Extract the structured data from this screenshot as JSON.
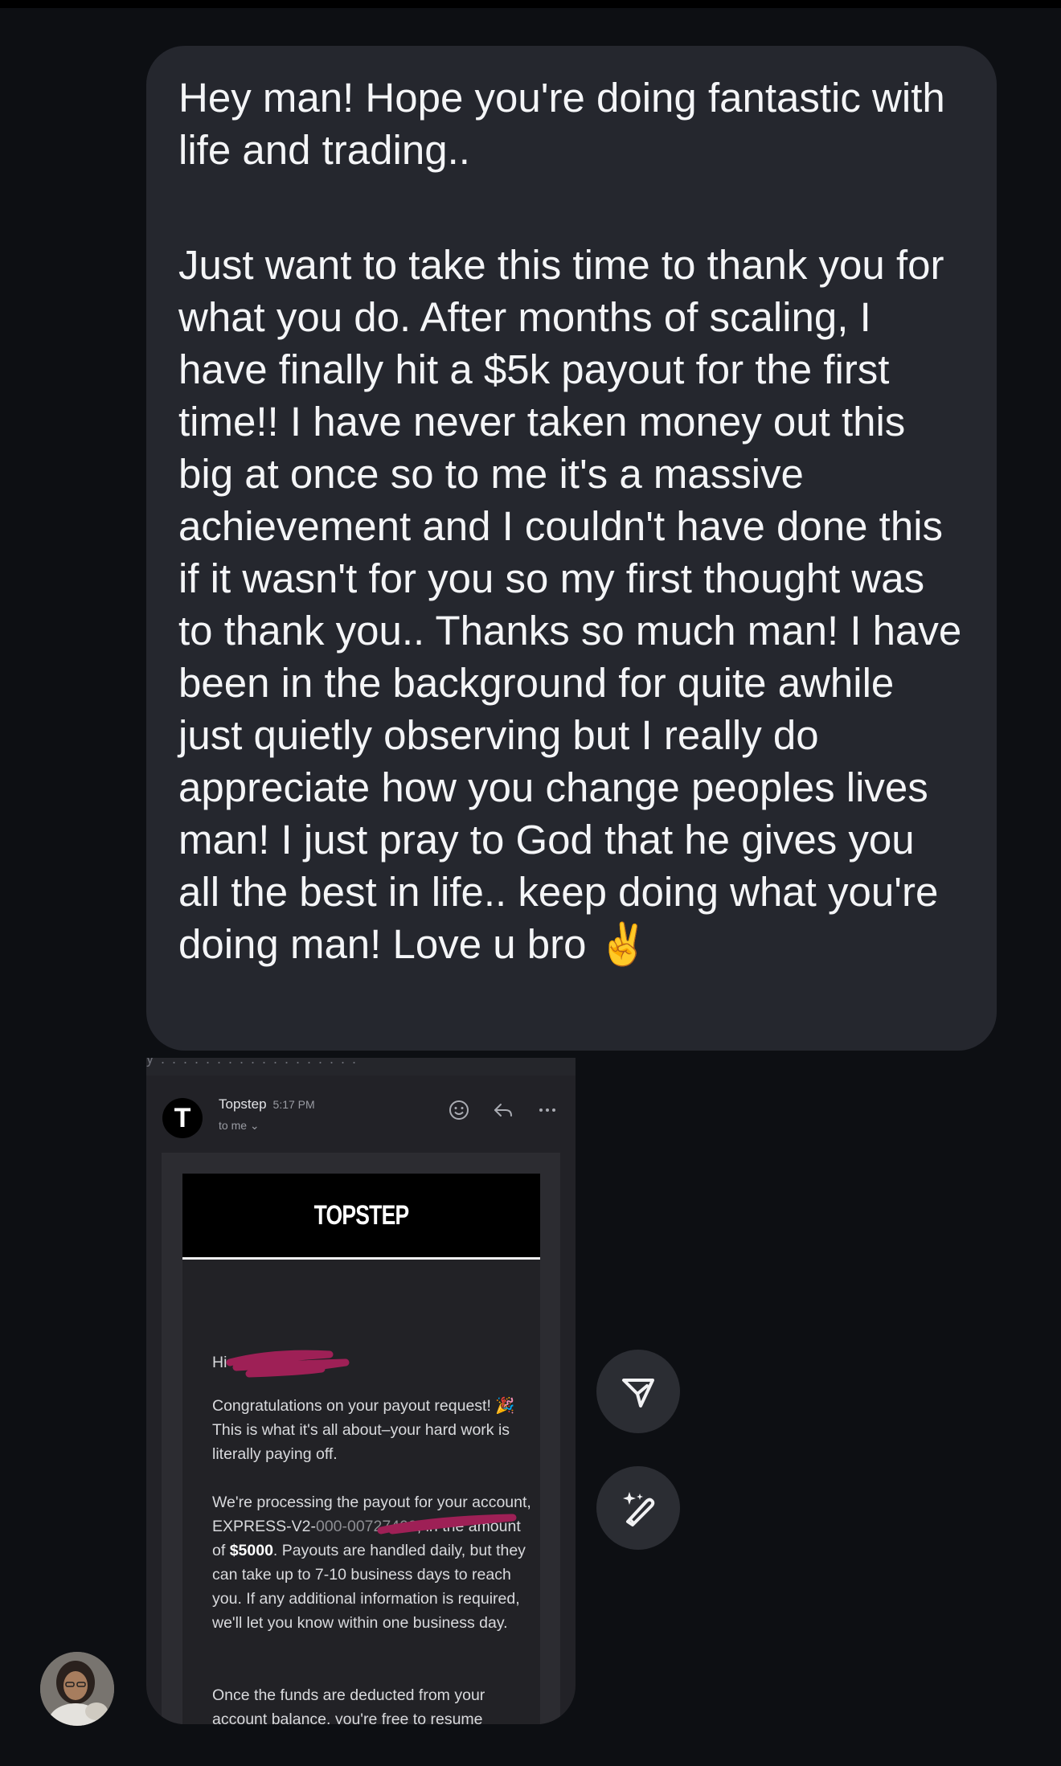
{
  "message": {
    "para1": "Hey man! Hope you're doing fantastic with life and trading..",
    "para2": "Just want to take this time to thank you for what you do. After months of scaling, I have finally hit a $5k payout for the first time!! I have never taken money out this big at once so to me it's a massive achievement and I couldn't have done this if it wasn't for you so my first thought was to thank you.. Thanks so much man! I have been in the background for quite awhile just quietly observing but I really do appreciate how you change peoples lives man! I just pray to God that he gives you all the best in life.. keep doing what you're doing man! Love u bro",
    "emoji": "✌️"
  },
  "email": {
    "cut_text": "y . . . . . . . . . . . . . . . . . .",
    "avatar_letter": "T",
    "sender": "Topstep",
    "time": "5:17 PM",
    "to": "to me ⌄",
    "brand": "TOPSTEP",
    "greeting": "Hi",
    "para1_a": "Congratulations on your payout request! ",
    "party_emoji": "🎉",
    "para1_b": " This is what it's all about–your hard work is literally paying off.",
    "para2_a": "We're processing the payout for your account, EXPRESS-V2-",
    "para2_redacted": "000-00727402",
    "para2_b": ", in the amount of ",
    "amount": "$5000",
    "para2_c": ". Payouts are handled daily, but they can take up to 7-10 business days to reach you. If any additional information is required, we'll let you know within one business day.",
    "para3": "Once the funds are deducted from your account balance, you're free to resume"
  },
  "icons": {
    "emoji_react": "smiley-icon",
    "reply": "reply-icon",
    "more": "more-icon",
    "send": "send-icon",
    "edit": "magic-pen-icon"
  },
  "colors": {
    "background": "#0d0f13",
    "bubble": "#25272e",
    "redaction": "#9e2056"
  }
}
